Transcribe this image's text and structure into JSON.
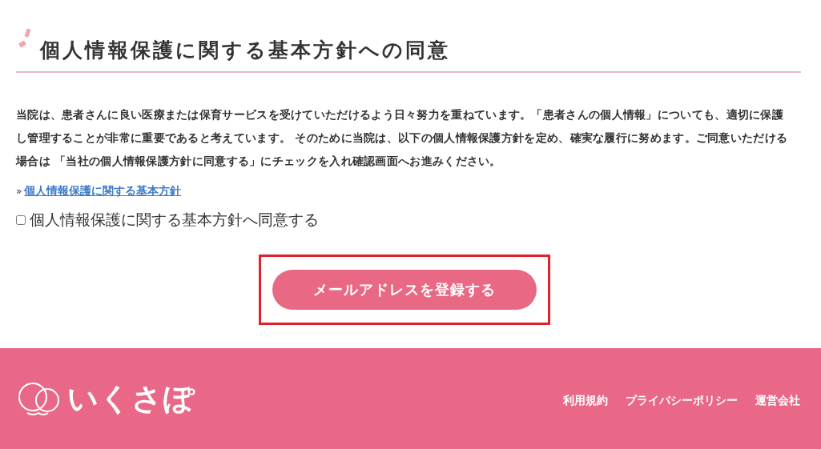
{
  "heading": "個人情報保護に関する基本方針への同意",
  "paragraph": "当院は、患者さんに良い医療または保育サービスを受けていただけるよう日々努力を重ねています。「患者さんの個人情報」についても、適切に保護し管理することが非常に重要であると考えています。 そのために当院は、以下の個人情報保護方針を定め、確実な履行に努めます。ご同意いただける場合は 「当社の個人情報保護方針に同意する」にチェックを入れ確認画面へお進みください。",
  "link": {
    "marker": "»",
    "label": "個人情報保護に関する基本方針"
  },
  "consent": {
    "label": "個人情報保護に関する基本方針へ同意する",
    "checked": false
  },
  "submit_button": {
    "label": "メールアドレスを登録する",
    "highlighted": true
  },
  "footer": {
    "logo": "いくさぽ",
    "links": [
      "利用規約",
      "プライバシーポリシー",
      "運営会社"
    ]
  }
}
